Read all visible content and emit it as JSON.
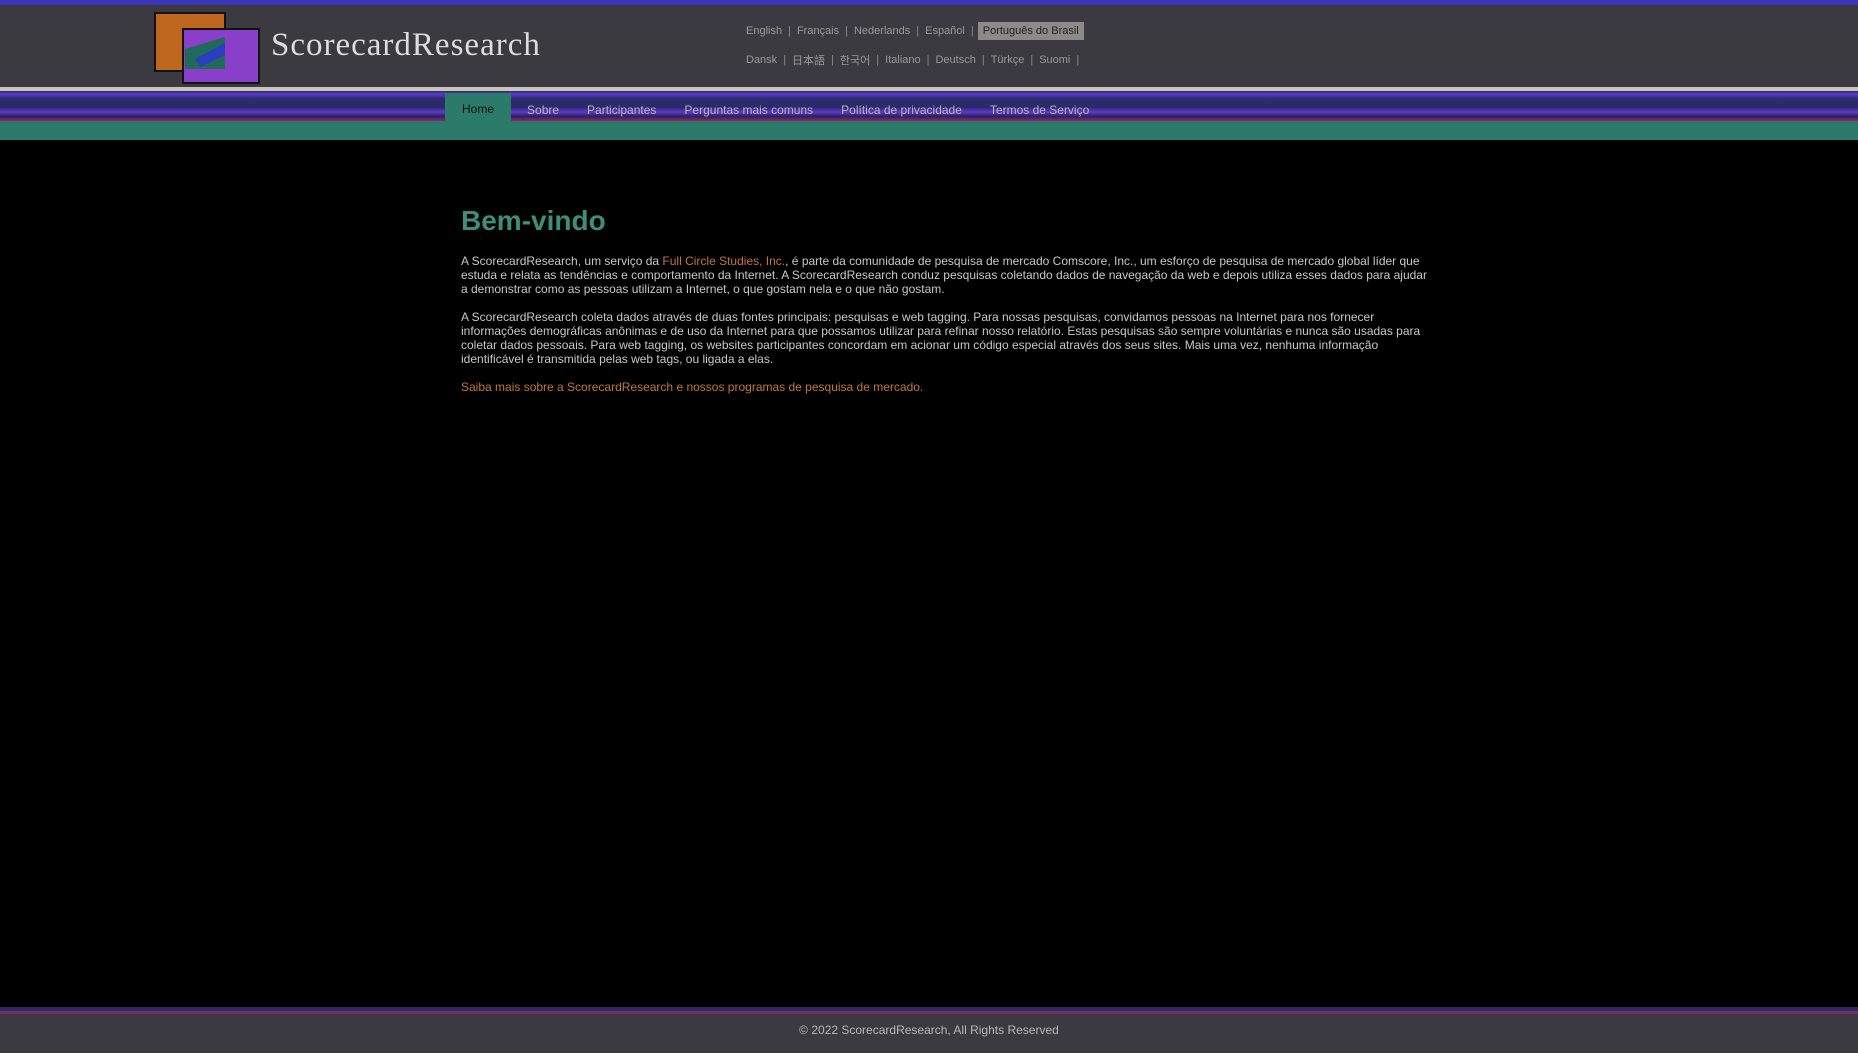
{
  "header": {
    "logo_text": "ScorecardResearch",
    "languages_row1": [
      {
        "label": "English",
        "active": false
      },
      {
        "label": "Français",
        "active": false
      },
      {
        "label": "Nederlands",
        "active": false
      },
      {
        "label": "Español",
        "active": false
      },
      {
        "label": "Português do Brasil",
        "active": true
      }
    ],
    "languages_row2": [
      {
        "label": "Dansk",
        "active": false
      },
      {
        "label": "日本語",
        "active": false
      },
      {
        "label": "한국어",
        "active": false
      },
      {
        "label": "Italiano",
        "active": false
      },
      {
        "label": "Deutsch",
        "active": false
      },
      {
        "label": "Türkçe",
        "active": false
      },
      {
        "label": "Suomi",
        "active": false
      }
    ]
  },
  "nav": {
    "items": [
      {
        "label": "Home",
        "active": true
      },
      {
        "label": "Sobre",
        "active": false
      },
      {
        "label": "Participantes",
        "active": false
      },
      {
        "label": "Perguntas mais comuns",
        "active": false
      },
      {
        "label": "Política de privacidade",
        "active": false
      },
      {
        "label": "Termos de Serviço",
        "active": false
      }
    ]
  },
  "main": {
    "title": "Bem-vindo",
    "p1_before": "A ScorecardResearch, um serviço da ",
    "p1_link": "Full Circle Studies, Inc.",
    "p1_after": ", é parte da comunidade de pesquisa de mercado Comscore, Inc., um esforço de pesquisa de mercado global líder que estuda e relata as tendências e comportamento da Internet. A ScorecardResearch conduz pesquisas coletando dados de navegação da web e depois utiliza esses dados para ajudar a demonstrar como as pessoas utilizam a Internet, o que gostam nela e o que não gostam.",
    "p2": "A ScorecardResearch coleta dados através de duas fontes principais: pesquisas e web tagging. Para nossas pesquisas, convidamos pessoas na Internet para nos fornecer informações demográficas anônimas e de uso da Internet para que possamos utilizar para refinar nosso relatório. Estas pesquisas são sempre voluntárias e nunca são usadas para coletar dados pessoais. Para web tagging, os websites participantes concordam em acionar um código especial através dos seus sites. Mais uma vez, nenhuma informação identificável é transmitida pelas web tags, ou ligada a elas.",
    "learn_more_link": "Saiba mais sobre a ScorecardResearch e nossos programas de pesquisa de mercado."
  },
  "footer": {
    "copyright": "© 2022 ScorecardResearch, All Rights Reserved"
  },
  "colors": {
    "header_bg": "#3a3a40",
    "accent_teal": "#2c7a6a",
    "heading_green": "#3e8e7a",
    "link_orange": "#c0773a",
    "band_purple": "#5a3bd0",
    "active_lang_bg": "#8c8a88"
  }
}
